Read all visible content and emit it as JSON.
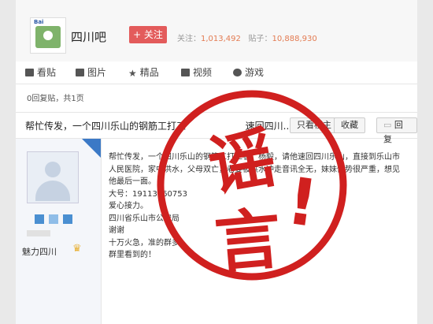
{
  "forum": {
    "logo_brand": "Bai",
    "name": "四川吧",
    "follow_label": "+ 关注",
    "follow_count_label": "关注：",
    "follow_count": "1,013,492",
    "post_count_label": "贴子：",
    "post_count": "10,888,930"
  },
  "tabs": [
    {
      "label": "看贴",
      "icon": "document-icon"
    },
    {
      "label": "图片",
      "icon": "image-icon"
    },
    {
      "label": "精品",
      "icon": "star-icon"
    },
    {
      "label": "视频",
      "icon": "video-icon"
    },
    {
      "label": "游戏",
      "icon": "gamepad-icon"
    }
  ],
  "thread": {
    "reply_summary": "0回复贴，共1页",
    "title": "帮忙传发，一个四川乐山的钢筋工打工",
    "title_tail": "速回四川...",
    "only_op_label": "只看楼主",
    "favorite_label": "收藏",
    "reply_label": "回复"
  },
  "post": {
    "username": "魅力四川",
    "lines": [
      "帮忙传发，一个四川乐山的钢筋工打工者，杨毅，请他速回四川乐山，直接到乐山市",
      "人民医院，家中洪水，父母双亡，老婆被洪水冲走音讯全无，妹妹伤势很严重，想见",
      "他最后一面。",
      "大号：19113260753",
      "爱心接力。",
      "四川省乐山市公安局",
      "谢谢",
      "十万火急，准的群多",
      "群里看到的！"
    ]
  },
  "stamp": {
    "text_top": "谣",
    "text_bottom": "言",
    "mark": "!",
    "color": "#d0201f"
  }
}
